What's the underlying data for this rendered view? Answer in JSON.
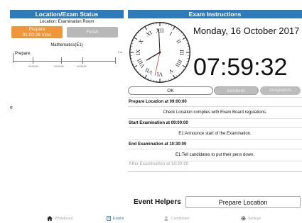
{
  "left": {
    "header": "Location/Exam Status",
    "location": "Location: Examination Room",
    "prepare_button": {
      "line1": "Prepare",
      "line2": "01:00:26 mins"
    },
    "finish_button": "Finish",
    "subject": "Mathematics(E1)",
    "timeline": {
      "label": "Prepare",
      "end_label": "5 m",
      "ticks": [
        "09:00:00",
        "10:00:00",
        "10:30:00"
      ]
    },
    "side_text": "e"
  },
  "right": {
    "header": "Exam Instructions",
    "date": "Monday, 16 October 2017",
    "time": "07:59:32",
    "clock": {
      "hour": 7,
      "minute": 59,
      "second": 32
    },
    "actions": {
      "ok": "OK",
      "incidents": "Incidents",
      "invigilators": "Invigilators"
    },
    "instructions": [
      {
        "title": "Prepare Location at 09:00:00",
        "body": "Check Location complies with Exam Board regulations."
      },
      {
        "title": "Start Examination at 09:00:00",
        "body": "E1:Announce start of the Examination."
      },
      {
        "title": "End Examination at 10:30:00",
        "body": "E1:Tell candidates to put their pens down."
      },
      {
        "title": "After Examination at 10:30:00"
      }
    ],
    "helpers": {
      "label": "Event Helpers",
      "button": "Prepare Location"
    }
  },
  "tabs": [
    {
      "label": "Whiteboard",
      "icon": "home-icon",
      "active": false
    },
    {
      "label": "Exams",
      "icon": "exams-icon",
      "active": true
    },
    {
      "label": "Candidates",
      "icon": "candidates-icon",
      "active": false
    },
    {
      "label": "Settings",
      "icon": "gear-icon",
      "active": false
    }
  ],
  "colors": {
    "header": "#2f7ab8",
    "prepare": "#f0963a",
    "disabled": "#b8b8b8"
  }
}
